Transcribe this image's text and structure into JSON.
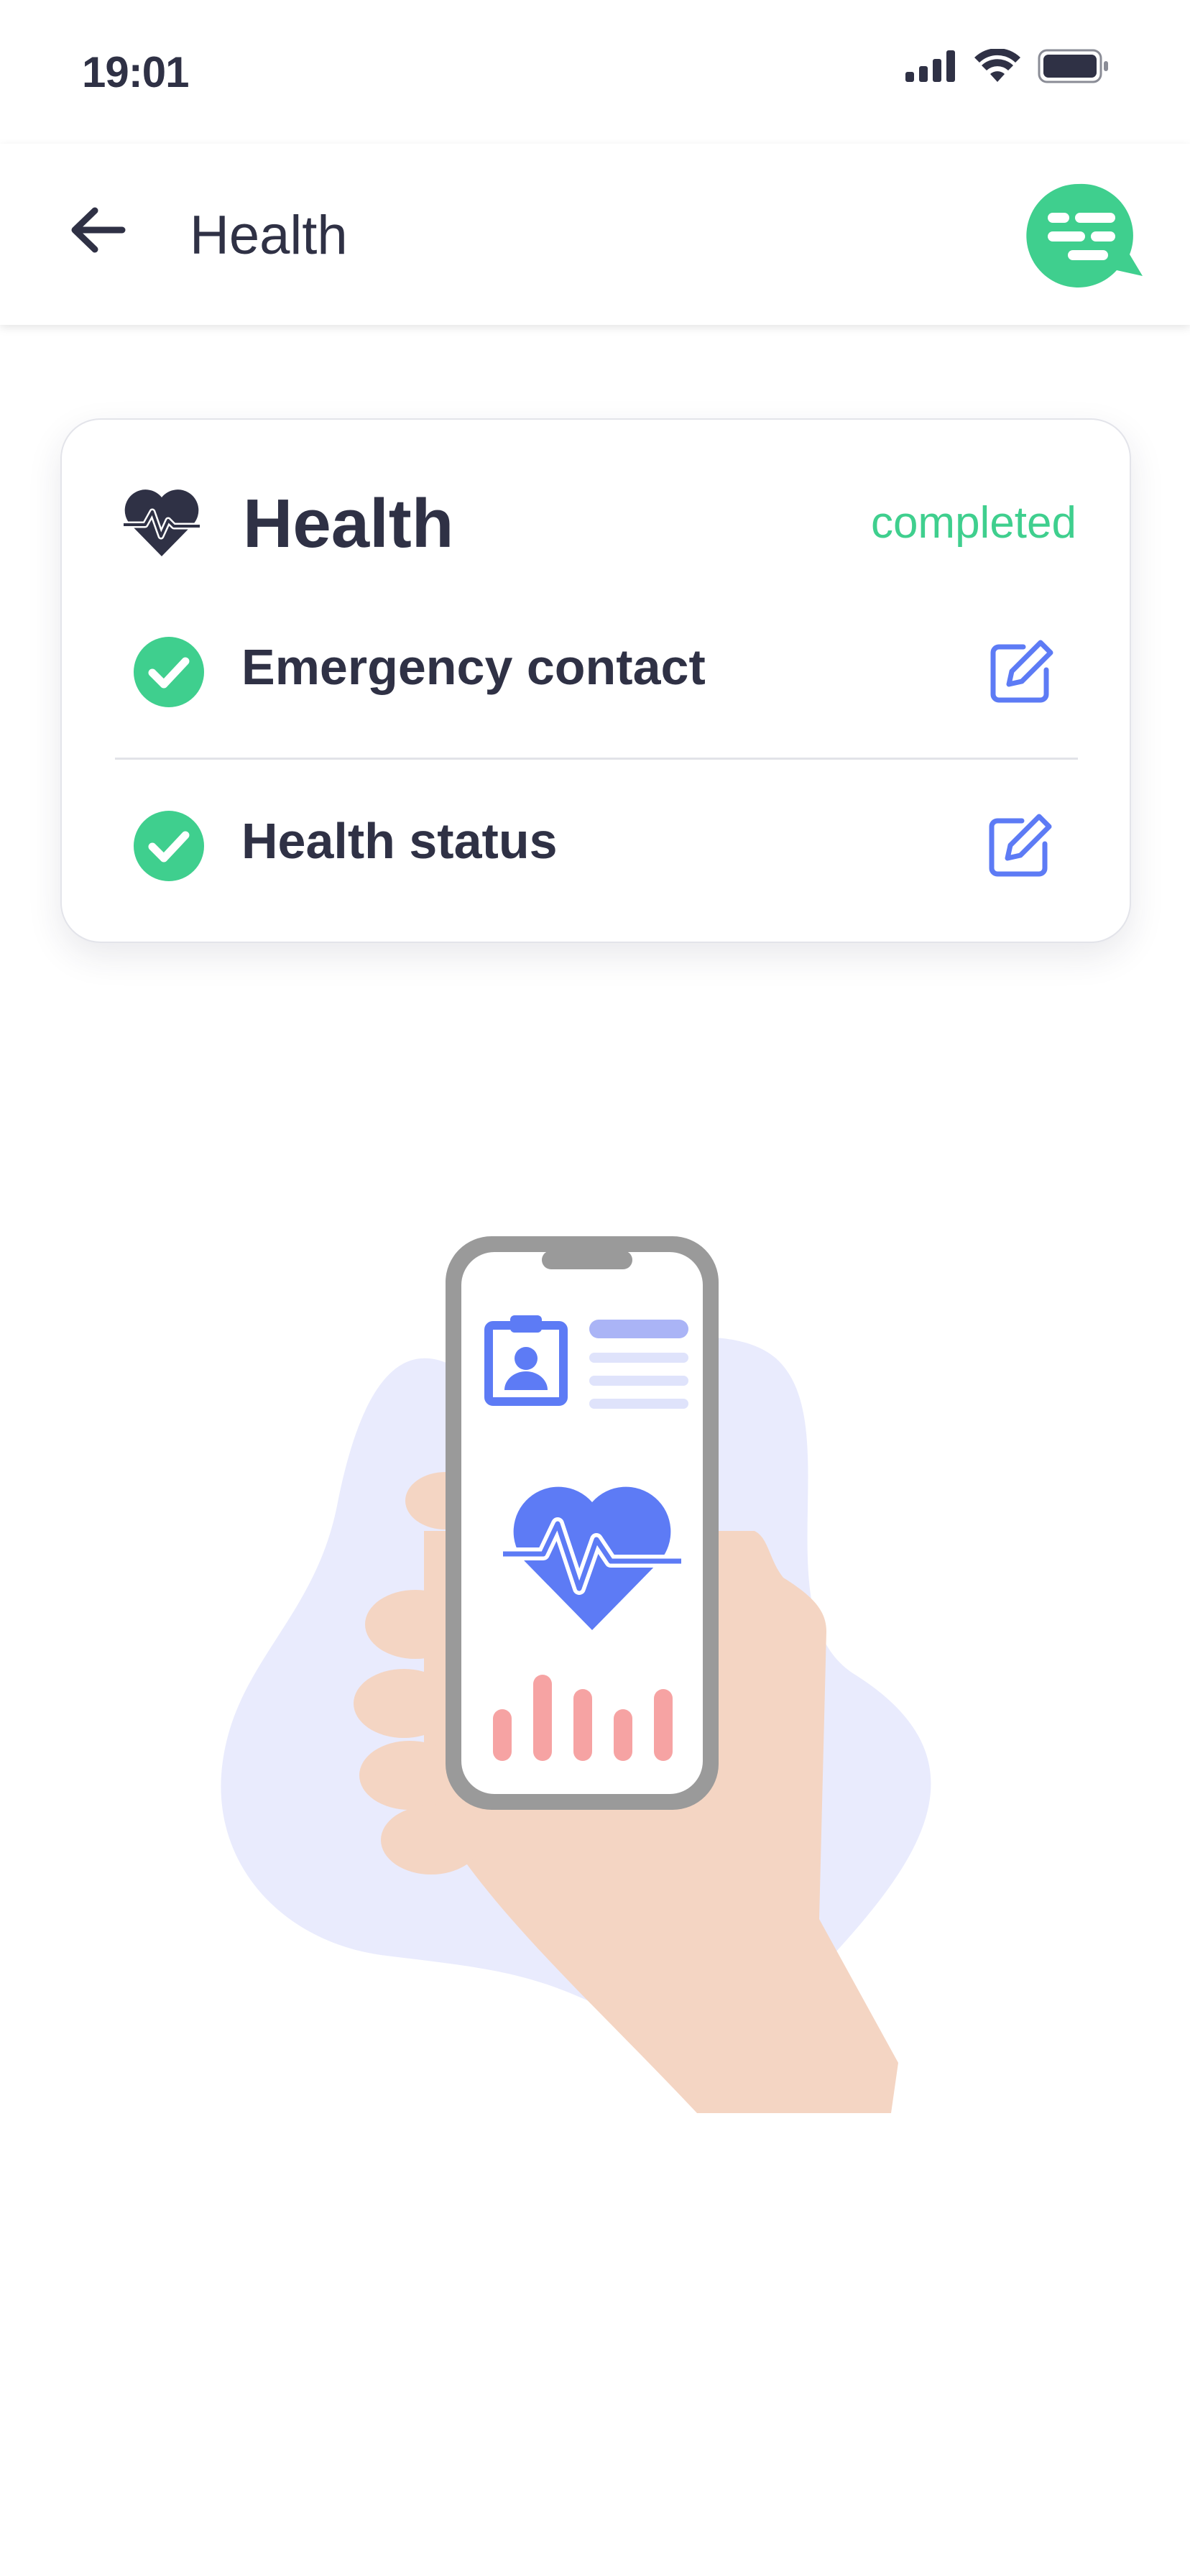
{
  "status_bar": {
    "time": "19:01",
    "icons": [
      "signal-icon",
      "wifi-icon",
      "battery-icon"
    ]
  },
  "header": {
    "back_icon": "arrow-left-icon",
    "title": "Health",
    "chat_icon": "chat-bubble-icon"
  },
  "card": {
    "icon": "heart-pulse-icon",
    "title": "Health",
    "status": "completed",
    "items": [
      {
        "label": "Emergency contact",
        "check_icon": "check-circle-icon",
        "edit_icon": "edit-icon"
      },
      {
        "label": "Health status",
        "check_icon": "check-circle-icon",
        "edit_icon": "edit-icon"
      }
    ]
  },
  "illustration": {
    "name": "hand-holding-phone-health-illustration"
  },
  "colors": {
    "accent_green": "#3fcf8e",
    "accent_blue": "#5d7bf5",
    "text_dark": "#2f3145",
    "blob": "#e9ebfd",
    "skin": "#f4d5c3",
    "bars": "#f6a3a3",
    "phone_frame": "#9a9a9a"
  }
}
